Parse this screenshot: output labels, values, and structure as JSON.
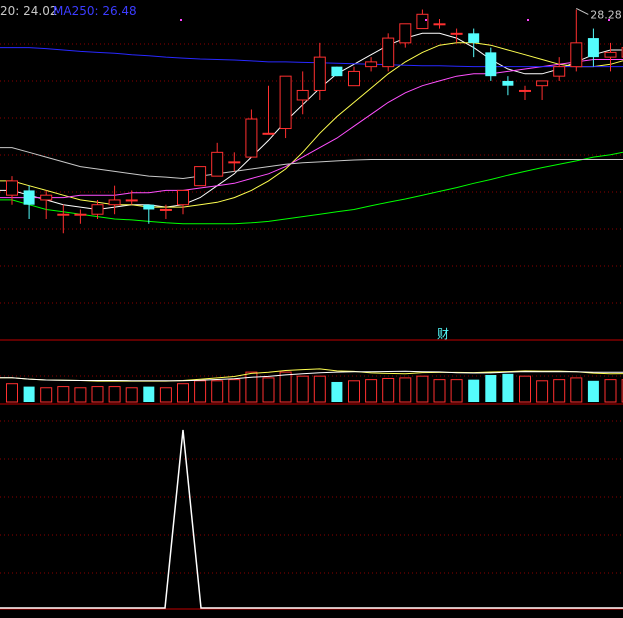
{
  "legend": {
    "ma_label_1": "20: 24.02",
    "ma_label_2": "MA250: 26.48"
  },
  "annotations": {
    "peak_label": "28.28",
    "cai_icon": "财"
  },
  "colors": {
    "background": "#000000",
    "up_candle": "#ff3030",
    "down_candle": "#54fcfc",
    "ma5": "#ffffff",
    "ma10": "#ffff50",
    "ma20": "#ff50ff",
    "ma60": "#00ff00",
    "ma120": "#c8c8c8",
    "ma250": "#2828ff",
    "grid": "#8b0000",
    "divider": "#c00000",
    "signal": "#ffffff",
    "label_text": "#c8c8c8",
    "ma250_text": "#3c3cff"
  },
  "chart_data": {
    "type": "candlestick",
    "price_ylim": [
      21.4,
      28.5
    ],
    "volume_ylim": [
      0,
      100
    ],
    "signal_ylim": [
      0,
      1
    ],
    "candles": [
      {
        "o": 24.4,
        "h": 24.8,
        "l": 24.2,
        "c": 24.7
      },
      {
        "o": 24.5,
        "h": 24.6,
        "l": 23.9,
        "c": 24.2
      },
      {
        "o": 24.3,
        "h": 24.5,
        "l": 23.9,
        "c": 24.4
      },
      {
        "o": 24.0,
        "h": 24.2,
        "l": 23.6,
        "c": 24.0
      },
      {
        "o": 24.0,
        "h": 24.1,
        "l": 23.8,
        "c": 24.0
      },
      {
        "o": 24.0,
        "h": 24.3,
        "l": 23.9,
        "c": 24.2
      },
      {
        "o": 24.2,
        "h": 24.6,
        "l": 24.0,
        "c": 24.3
      },
      {
        "o": 24.3,
        "h": 24.5,
        "l": 24.2,
        "c": 24.3
      },
      {
        "o": 24.2,
        "h": 24.2,
        "l": 23.8,
        "c": 24.1
      },
      {
        "o": 24.1,
        "h": 24.2,
        "l": 23.9,
        "c": 24.1
      },
      {
        "o": 24.2,
        "h": 24.3,
        "l": 24.0,
        "c": 24.5
      },
      {
        "o": 24.6,
        "h": 24.8,
        "l": 24.6,
        "c": 25.0
      },
      {
        "o": 24.8,
        "h": 25.5,
        "l": 24.8,
        "c": 25.3
      },
      {
        "o": 25.1,
        "h": 25.3,
        "l": 24.9,
        "c": 25.1
      },
      {
        "o": 25.2,
        "h": 26.2,
        "l": 25.2,
        "c": 26.0
      },
      {
        "o": 25.7,
        "h": 26.7,
        "l": 25.7,
        "c": 25.7
      },
      {
        "o": 25.8,
        "h": 26.9,
        "l": 25.6,
        "c": 26.9
      },
      {
        "o": 26.4,
        "h": 27.0,
        "l": 26.1,
        "c": 26.6
      },
      {
        "o": 26.6,
        "h": 27.6,
        "l": 26.4,
        "c": 27.3
      },
      {
        "o": 27.1,
        "h": 27.1,
        "l": 26.9,
        "c": 26.9
      },
      {
        "o": 26.7,
        "h": 27.1,
        "l": 26.7,
        "c": 27.0
      },
      {
        "o": 27.1,
        "h": 27.3,
        "l": 27.0,
        "c": 27.2
      },
      {
        "o": 27.1,
        "h": 27.8,
        "l": 27.0,
        "c": 27.7
      },
      {
        "o": 27.6,
        "h": 28.0,
        "l": 27.5,
        "c": 28.0
      },
      {
        "o": 27.9,
        "h": 28.3,
        "l": 27.9,
        "c": 28.2
      },
      {
        "o": 28.0,
        "h": 28.1,
        "l": 27.9,
        "c": 28.0
      },
      {
        "o": 27.8,
        "h": 27.9,
        "l": 27.6,
        "c": 27.8
      },
      {
        "o": 27.8,
        "h": 27.9,
        "l": 27.3,
        "c": 27.6
      },
      {
        "o": 27.4,
        "h": 27.5,
        "l": 26.8,
        "c": 26.9
      },
      {
        "o": 26.8,
        "h": 26.9,
        "l": 26.5,
        "c": 26.7
      },
      {
        "o": 26.6,
        "h": 26.7,
        "l": 26.4,
        "c": 26.6
      },
      {
        "o": 26.7,
        "h": 26.8,
        "l": 26.4,
        "c": 26.8
      },
      {
        "o": 26.9,
        "h": 27.3,
        "l": 26.8,
        "c": 27.1
      },
      {
        "o": 27.1,
        "h": 28.3,
        "l": 27.0,
        "c": 27.6
      },
      {
        "o": 27.7,
        "h": 27.9,
        "l": 27.1,
        "c": 27.3
      },
      {
        "o": 27.3,
        "h": 27.6,
        "l": 27.0,
        "c": 27.4
      },
      {
        "o": 27.3,
        "h": 27.6,
        "l": 27.2,
        "c": 27.5
      },
      {
        "o": 27.5,
        "h": 27.5,
        "l": 26.9,
        "c": 27.0
      },
      {
        "o": 27.0,
        "h": 27.2,
        "l": 26.5,
        "c": 26.8
      }
    ],
    "volume": [
      35,
      30,
      28,
      30,
      28,
      30,
      30,
      28,
      30,
      28,
      35,
      40,
      40,
      42,
      55,
      45,
      55,
      48,
      48,
      38,
      40,
      42,
      44,
      45,
      48,
      42,
      42,
      42,
      50,
      52,
      48,
      40,
      42,
      45,
      40,
      42,
      42,
      40,
      42
    ],
    "ma_lines": [
      {
        "name": "MA5",
        "values": [
          24.5,
          24.4,
          24.3,
          24.2,
          24.15,
          24.1,
          24.15,
          24.2,
          24.2,
          24.15,
          24.2,
          24.35,
          24.6,
          24.85,
          25.2,
          25.55,
          25.95,
          26.3,
          26.65,
          26.95,
          27.15,
          27.35,
          27.55,
          27.7,
          27.8,
          27.8,
          27.7,
          27.5,
          27.25,
          27.05,
          26.95,
          26.95,
          27.05,
          27.2,
          27.35,
          27.45,
          27.45,
          27.35,
          27.2
        ]
      },
      {
        "name": "MA10",
        "values": [
          24.7,
          24.6,
          24.5,
          24.4,
          24.3,
          24.25,
          24.2,
          24.2,
          24.15,
          24.15,
          24.15,
          24.2,
          24.25,
          24.35,
          24.5,
          24.7,
          24.95,
          25.3,
          25.7,
          26.05,
          26.35,
          26.65,
          26.95,
          27.2,
          27.4,
          27.55,
          27.6,
          27.6,
          27.55,
          27.45,
          27.35,
          27.25,
          27.15,
          27.1,
          27.1,
          27.15,
          27.25,
          27.3,
          27.25
        ]
      },
      {
        "name": "MA20",
        "values": [
          24.35,
          24.35,
          24.35,
          24.35,
          24.4,
          24.4,
          24.4,
          24.45,
          24.45,
          24.5,
          24.5,
          24.55,
          24.6,
          24.65,
          24.75,
          24.85,
          25.0,
          25.2,
          25.4,
          25.6,
          25.85,
          26.1,
          26.35,
          26.55,
          26.7,
          26.8,
          26.9,
          26.95,
          26.95,
          27.0,
          27.05,
          27.1,
          27.15,
          27.2,
          27.25,
          27.25,
          27.25,
          27.2,
          27.15
        ]
      },
      {
        "name": "MA60",
        "values": [
          24.3,
          24.2,
          24.1,
          24.05,
          24.0,
          23.95,
          23.9,
          23.88,
          23.85,
          23.82,
          23.8,
          23.8,
          23.8,
          23.8,
          23.82,
          23.85,
          23.9,
          23.95,
          24.0,
          24.05,
          24.1,
          24.18,
          24.25,
          24.32,
          24.4,
          24.48,
          24.56,
          24.65,
          24.73,
          24.82,
          24.9,
          24.98,
          25.05,
          25.12,
          25.2,
          25.25,
          25.32,
          25.38,
          25.45
        ]
      },
      {
        "name": "MA120",
        "values": [
          25.4,
          25.3,
          25.2,
          25.1,
          25.0,
          24.95,
          24.9,
          24.85,
          24.8,
          24.78,
          24.75,
          24.8,
          24.85,
          24.9,
          24.95,
          25.0,
          25.05,
          25.08,
          25.1,
          25.12,
          25.14,
          25.15,
          25.15,
          25.15,
          25.15,
          25.15,
          25.15,
          25.15,
          25.15,
          25.15,
          25.15,
          25.15,
          25.15,
          25.15,
          25.15,
          25.15,
          25.15,
          25.15,
          25.15
        ]
      },
      {
        "name": "MA250",
        "values": [
          27.5,
          27.5,
          27.48,
          27.45,
          27.42,
          27.4,
          27.38,
          27.35,
          27.33,
          27.3,
          27.28,
          27.26,
          27.25,
          27.24,
          27.22,
          27.2,
          27.2,
          27.19,
          27.18,
          27.17,
          27.16,
          27.15,
          27.14,
          27.13,
          27.12,
          27.12,
          27.11,
          27.1,
          27.1,
          27.1,
          27.1,
          27.1,
          27.1,
          27.1,
          27.1,
          27.1,
          27.1,
          27.1,
          27.1
        ]
      }
    ],
    "signal": [
      0,
      0,
      0,
      0,
      0,
      0,
      0,
      0,
      0,
      0,
      1,
      0,
      0,
      0,
      0,
      0,
      0,
      0,
      0,
      0,
      0,
      0,
      0,
      0,
      0,
      0,
      0,
      0,
      0,
      0,
      0,
      0,
      0,
      0,
      0,
      0,
      0,
      0,
      0
    ],
    "peak_marker_index": 33,
    "peak_value": 28.28,
    "grid": true
  }
}
